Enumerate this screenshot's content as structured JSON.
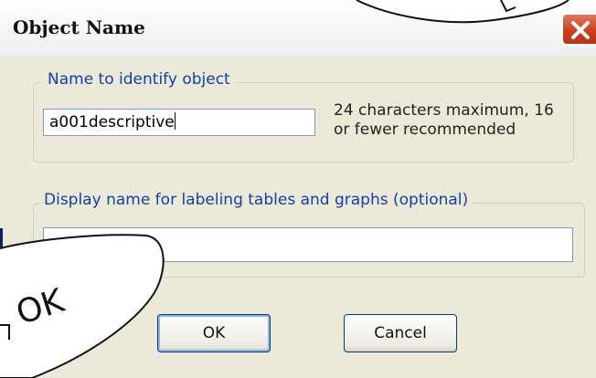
{
  "dialog": {
    "title": "Object Name",
    "close_icon": "close-icon"
  },
  "name_group": {
    "legend": "Name to identify object",
    "value": "a001descriptive",
    "hint_line1": "24 characters maximum, 16",
    "hint_line2": "or fewer recommended"
  },
  "display_group": {
    "legend": "Display name for labeling tables and graphs  (optional)",
    "value": ""
  },
  "buttons": {
    "ok": "OK",
    "cancel": "Cancel"
  },
  "annotation": {
    "callout_label": "OK"
  },
  "colors": {
    "legend_text": "#1240ab",
    "dialog_face": "#ece9d8",
    "close_button": "#c8411e"
  }
}
